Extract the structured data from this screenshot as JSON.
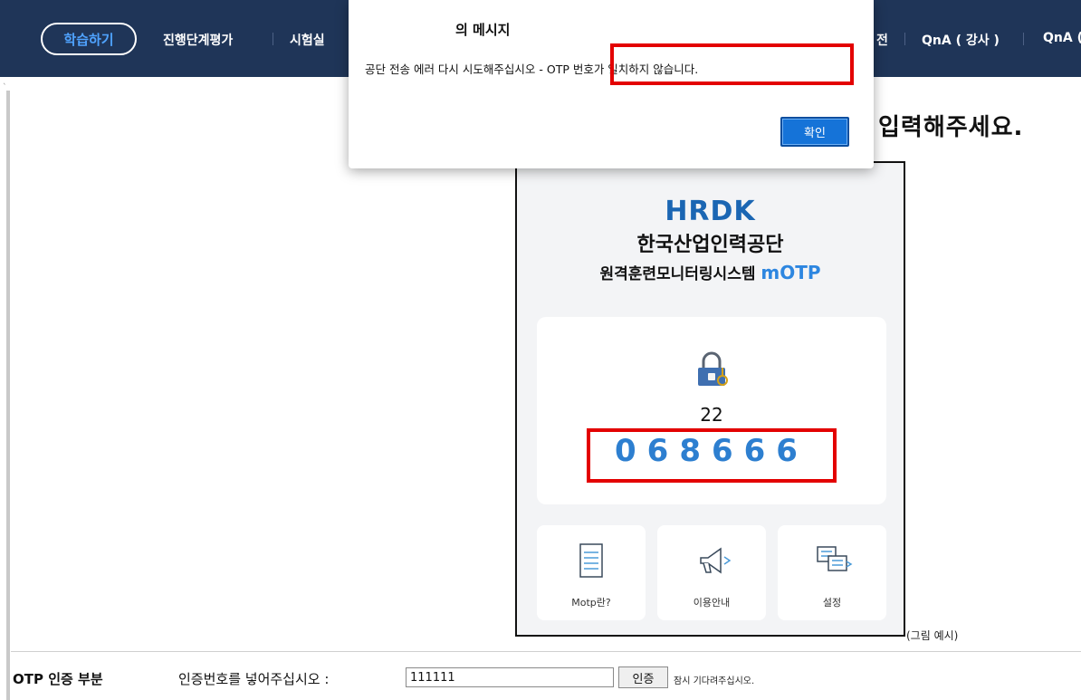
{
  "nav": {
    "active_tab": "학습하기",
    "items": [
      "진행단계평가",
      "시험실",
      "전",
      "QnA ( 강사 )",
      "QnA ("
    ]
  },
  "heading_fragment": "입력해주세요.",
  "dialog": {
    "title": "의 메시지",
    "message": "공단 전송 에러 다시 시도해주십시오 - OTP 번호가 일치하지 않습니다.",
    "confirm_label": "확인"
  },
  "phone": {
    "logo": "HRDK",
    "org_name": "한국산업인력공단",
    "system_name": "원격훈련모니터링시스템",
    "system_accent": "mOTP",
    "counter": "22",
    "otp_code": "068666",
    "tiles": [
      "Motp란?",
      "이용안내",
      "설정"
    ]
  },
  "figure_caption": "(그림 예시)",
  "otp_form": {
    "section_label": "OTP 인증 부분",
    "prompt": "인증번호를 넣어주십시오 :",
    "input_value": "111111",
    "button_label": "인증",
    "wait_text": "잠시 기다려주십시오."
  },
  "colors": {
    "nav_bg": "#1f3558",
    "accent_blue": "#2d7fd0",
    "highlight_red": "#e30000",
    "confirm_blue": "#1573d8"
  }
}
